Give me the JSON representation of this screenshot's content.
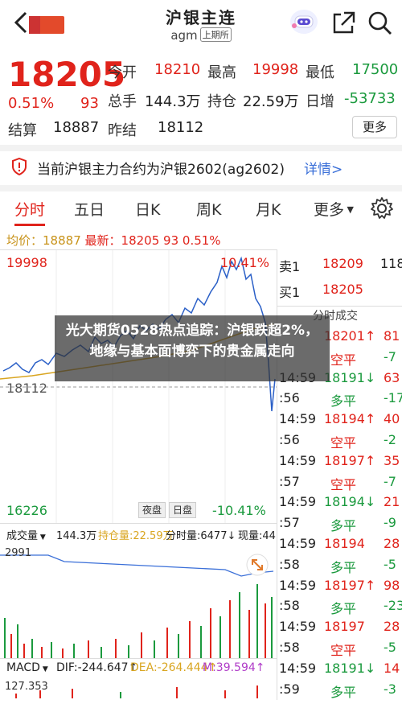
{
  "header": {
    "title": "沪银主连",
    "subtitle": "agm",
    "tag": "上期所"
  },
  "quote": {
    "price": "18205",
    "pct": "0.51%",
    "change": "93",
    "open_label": "今开",
    "open": "18210",
    "high_label": "最高",
    "high": "19998",
    "low_label": "最低",
    "low": "17500",
    "vol_label": "总手",
    "vol": "144.3万",
    "oi_label": "持仓",
    "oi": "22.59万",
    "daily_add_label": "日增",
    "daily_add": "-53733",
    "settle_label": "结算",
    "settle": "18887",
    "prev_label": "昨结",
    "prev": "18112",
    "more": "更多"
  },
  "notice": {
    "text": "当前沪银主力合约为沪银2602(ag2602)",
    "link": "详情>"
  },
  "tabs": [
    "分时",
    "五日",
    "日K",
    "周K",
    "月K",
    "更多"
  ],
  "avg_info": {
    "avg_label": "均价：",
    "avg": "18887",
    "latest_label": "最新：",
    "latest": "18205",
    "chg": "93",
    "pct": "0.51%"
  },
  "chart_labels": {
    "top_price": "19998",
    "top_pct": "10.41%",
    "mid_price": "18112",
    "bot_price": "16226",
    "bot_pct": "-10.41%",
    "night": "夜盘",
    "day": "日盘"
  },
  "order_book": {
    "sell_label": "卖1",
    "sell_price": "18209",
    "sell_qty": "118",
    "buy_label": "买1",
    "buy_price": "18205",
    "buy_qty": "",
    "trade_label": "分时成交"
  },
  "trades": [
    {
      "time": "",
      "price": "18201↑",
      "type": "",
      "qty": "81"
    },
    {
      "time": "",
      "price": "",
      "type": "空平",
      "qty": "-7"
    },
    {
      "time": "14:59",
      "price": "18191↓",
      "type": "",
      "qty": "63"
    },
    {
      "time": ":56",
      "price": "",
      "type": "多平",
      "qty": "-17"
    },
    {
      "time": "14:59",
      "price": "18194↑",
      "type": "",
      "qty": "40"
    },
    {
      "time": ":56",
      "price": "",
      "type": "空平",
      "qty": "-2"
    },
    {
      "time": "14:59",
      "price": "18197↑",
      "type": "",
      "qty": "35"
    },
    {
      "time": ":57",
      "price": "",
      "type": "空平",
      "qty": "-7"
    },
    {
      "time": "14:59",
      "price": "18194↓",
      "type": "",
      "qty": "21"
    },
    {
      "time": ":57",
      "price": "",
      "type": "多平",
      "qty": "-9"
    },
    {
      "time": "14:59",
      "price": "18194",
      "type": "",
      "qty": "28"
    },
    {
      "time": ":58",
      "price": "",
      "type": "多平",
      "qty": "-5"
    },
    {
      "time": "14:59",
      "price": "18197↑",
      "type": "",
      "qty": "98"
    },
    {
      "time": ":58",
      "price": "",
      "type": "多平",
      "qty": "-23"
    },
    {
      "time": "14:59",
      "price": "18197",
      "type": "",
      "qty": "28"
    },
    {
      "time": ":58",
      "price": "",
      "type": "空平",
      "qty": "-5"
    },
    {
      "time": "14:59",
      "price": "18191↓",
      "type": "",
      "qty": "14"
    },
    {
      "time": ":59",
      "price": "",
      "type": "多平",
      "qty": "-3"
    }
  ],
  "volume": {
    "label": "成交量",
    "vol": "144.3万",
    "oi": "持仓量:22.59万",
    "hand": "分时量:6477↓",
    "now": "现量:44",
    "max": "2991"
  },
  "macd": {
    "label": "MACD",
    "dif": "DIF:-244.647↑",
    "dea": "DEA:-264.444↑",
    "m": "M:39.594↑",
    "max": "127.353"
  },
  "overlay_text": "光大期货0528热点追踪：沪银跌超2%，地缘与基本面博弈下的贵金属走向",
  "colors": {
    "red": "#e0231b",
    "green": "#1b9a3e",
    "blue": "#3a6fd8",
    "avg": "#c8931a"
  }
}
